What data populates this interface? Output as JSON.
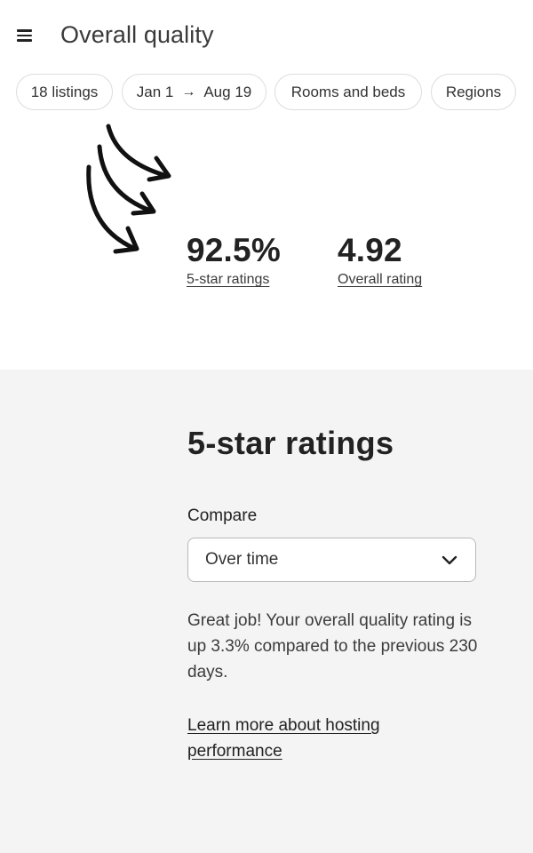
{
  "header": {
    "title": "Overall quality",
    "menu_icon": "hamburger-menu-icon"
  },
  "filters": [
    {
      "label": "18 listings"
    },
    {
      "start": "Jan 1",
      "end": "Aug 19",
      "arrow_icon": "right-arrow-icon"
    },
    {
      "label": "Rooms and beds"
    },
    {
      "label": "Regions"
    }
  ],
  "annotation": {
    "icon": "hand-drawn-arrows-icon",
    "color": "#111111"
  },
  "metrics": [
    {
      "value": "92.5%",
      "label": "5-star ratings"
    },
    {
      "value": "4.92",
      "label": "Overall rating"
    }
  ],
  "section": {
    "title": "5-star ratings",
    "compare_label": "Compare",
    "select_value": "Over time",
    "select_icon": "chevron-down-icon",
    "message": "Great job! Your overall quality rating is up 3.3% compared to the previous 230 days.",
    "link": "Learn more about hosting performance"
  },
  "colors": {
    "background": "#ffffff",
    "section_background": "#f4f4f4",
    "text": "#222222",
    "border": "#dddddd"
  }
}
